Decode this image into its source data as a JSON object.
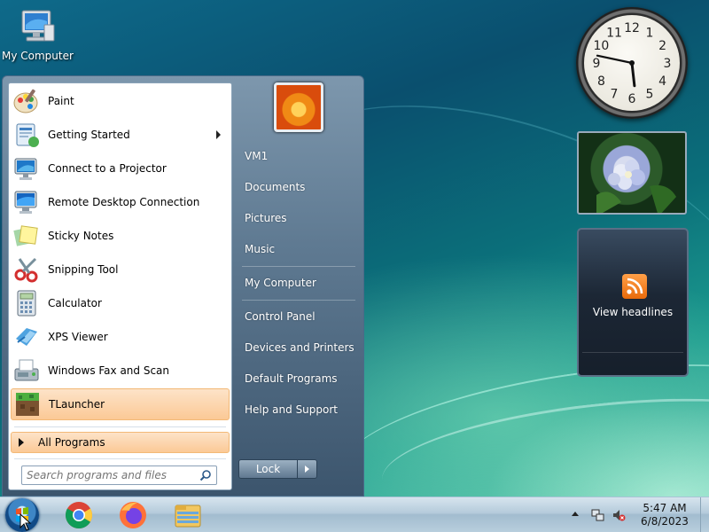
{
  "desktop": {
    "icons": [
      {
        "label": "My Computer",
        "icon": "computer-icon"
      }
    ]
  },
  "start_menu": {
    "programs": [
      {
        "label": "Paint",
        "icon": "paint-icon",
        "has_submenu": false
      },
      {
        "label": "Getting Started",
        "icon": "getting-started-icon",
        "has_submenu": true
      },
      {
        "label": "Connect to a Projector",
        "icon": "projector-icon",
        "has_submenu": false
      },
      {
        "label": "Remote Desktop Connection",
        "icon": "remote-desktop-icon",
        "has_submenu": false
      },
      {
        "label": "Sticky Notes",
        "icon": "sticky-notes-icon",
        "has_submenu": false
      },
      {
        "label": "Snipping Tool",
        "icon": "snipping-tool-icon",
        "has_submenu": false
      },
      {
        "label": "Calculator",
        "icon": "calculator-icon",
        "has_submenu": false
      },
      {
        "label": "XPS Viewer",
        "icon": "xps-viewer-icon",
        "has_submenu": false
      },
      {
        "label": "Windows Fax and Scan",
        "icon": "fax-scan-icon",
        "has_submenu": false
      },
      {
        "label": "TLauncher",
        "icon": "tlauncher-icon",
        "has_submenu": false,
        "selected": true
      }
    ],
    "all_programs_label": "All Programs",
    "search_placeholder": "Search programs and files",
    "right_items": [
      "VM1",
      "Documents",
      "Pictures",
      "Music",
      "My Computer",
      "Control Panel",
      "Devices and Printers",
      "Default Programs",
      "Help and Support"
    ],
    "lock_label": "Lock"
  },
  "gadgets": {
    "clock_numbers": [
      "12",
      "1",
      "2",
      "3",
      "4",
      "5",
      "6",
      "7",
      "8",
      "9",
      "10",
      "11"
    ],
    "clock_time": "5:47",
    "headlines_label": "View headlines"
  },
  "taskbar": {
    "pinned": [
      "chrome-icon",
      "firefox-icon",
      "file-explorer-icon"
    ],
    "time": "5:47 AM",
    "date": "6/8/2023"
  },
  "colors": {
    "selection_bg": "#fbc996",
    "start_menu_bg": "#5f7a92",
    "rss_orange": "#f08020"
  }
}
